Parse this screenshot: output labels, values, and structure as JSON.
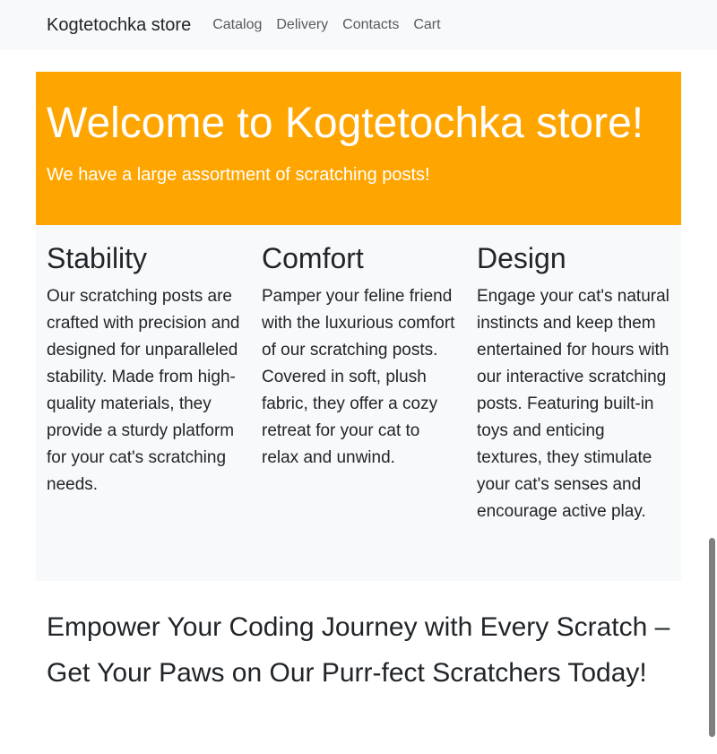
{
  "navbar": {
    "brand": "Kogtetochka store",
    "links": [
      {
        "label": "Catalog"
      },
      {
        "label": "Delivery"
      },
      {
        "label": "Contacts"
      },
      {
        "label": "Cart"
      }
    ]
  },
  "hero": {
    "title": "Welcome to Kogtetochka store!",
    "subtitle": "We have a large assortment of scratching posts!"
  },
  "features": [
    {
      "title": "Stability",
      "text": "Our scratching posts are crafted with precision and designed for unparalleled stability. Made from high-quality materials, they provide a sturdy platform for your cat's scratching needs."
    },
    {
      "title": "Comfort",
      "text": "Pamper your feline friend with the luxurious comfort of our scratching posts. Covered in soft, plush fabric, they offer a cozy retreat for your cat to relax and unwind."
    },
    {
      "title": "Design",
      "text": "Engage your cat's natural instincts and keep them entertained for hours with our interactive scratching posts. Featuring built-in toys and enticing textures, they stimulate your cat's senses and encourage active play."
    }
  ],
  "slogan": "Empower Your Coding Journey with Every Scratch – Get Your Paws on Our Purr-fect Scratchers Today!",
  "colors": {
    "hero_background": "#ffa500",
    "navbar_background": "#f8f9fa",
    "features_background": "#f8f9fa"
  }
}
